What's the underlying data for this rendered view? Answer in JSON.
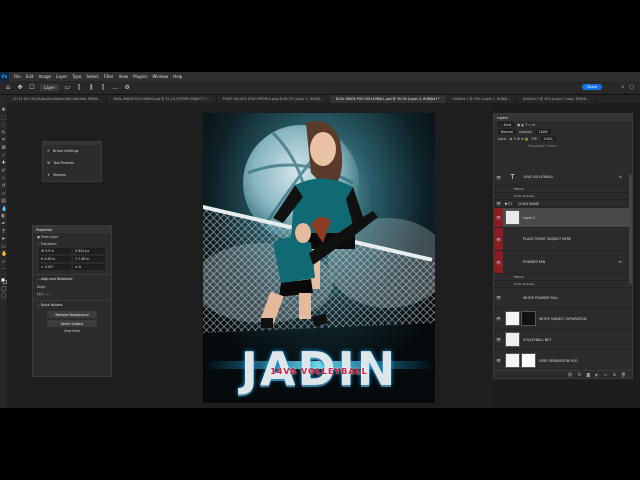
{
  "menubar": {
    "logo": "Ps",
    "items": [
      "File",
      "Edit",
      "Image",
      "Layer",
      "Type",
      "Select",
      "Filter",
      "View",
      "Plugins",
      "Window",
      "Help"
    ]
  },
  "optbar": {
    "layer_select": "Layer",
    "share_label": "Share"
  },
  "tabs": [
    {
      "label": "CH 11 US 178 (N-Box)/Invitation/Test AlionNet, R68/8...",
      "active": false
    },
    {
      "label": "DUAL IMAGE POG DARKS.psd @ 31.1% (STRIPE SUBJECT C...",
      "active": false
    },
    {
      "label": "POINT VILLAGE LOGO PROFILE.png @ 68.7% (Layer 1, RGB/8...",
      "active": false
    },
    {
      "label": "DUAL IMAGE POG VOLLEYBALL.psd @ 39.1% (Layer 2, RGB/8#) *",
      "active": true
    },
    {
      "label": "Untitled-1 @ 45% (Layer 1, RGB/8...",
      "active": false
    },
    {
      "label": "Untitled-3 @ 45% (Layer 1 copy, RGB/8...",
      "active": false
    }
  ],
  "float_panel": {
    "items": [
      "Brush Settings",
      "Tool Presets",
      "Shapes"
    ]
  },
  "properties": {
    "title": "Properties",
    "kind": "Pixel Layer",
    "transform_label": "Transform",
    "w": "3.9 in",
    "h": "4.85 in",
    "x": "624 px",
    "y": "2.38 in",
    "angle": "0.00°",
    "align_label": "Align and Distribute",
    "align_sub": "Align:",
    "quick_label": "Quick Actions",
    "btn_remove_bg": "Remove Background",
    "btn_select_subject": "Select Subject",
    "view_more": "View More"
  },
  "poster": {
    "name": "JADIN",
    "subtitle": "14VA VOLLEYBALL"
  },
  "layers_panel": {
    "title": "Layers",
    "filter": "Kind",
    "blend": "Normal",
    "opacity_label": "Opacity:",
    "opacity": "100%",
    "lock_label": "Lock:",
    "fill_label": "Fill:",
    "fill": "100%",
    "propagate": "Propagate Frame",
    "rows": [
      {
        "name": "14VA VOLLEYBALL",
        "kind": "text",
        "fx": "fx",
        "red": false,
        "selected": false
      },
      {
        "name": "Effects",
        "kind": "sub"
      },
      {
        "name": "Color Overlay",
        "kind": "sub"
      },
      {
        "name": "CHILD NAME",
        "kind": "folder",
        "fx": "",
        "red": false,
        "selected": false
      },
      {
        "name": "Layer 2",
        "kind": "pixel",
        "fx": "",
        "red": true,
        "selected": true
      },
      {
        "name": "PLACE FRONT SUBJECT HERE",
        "kind": "pixel",
        "fx": "",
        "red": true,
        "selected": false
      },
      {
        "name": "POWDER FAN",
        "kind": "pixel",
        "fx": "fx",
        "red": true,
        "selected": false
      },
      {
        "name": "Effects",
        "kind": "sub"
      },
      {
        "name": "Color Overlay",
        "kind": "sub"
      },
      {
        "name": "WHITE POWDER FALL",
        "kind": "pixel",
        "fx": "",
        "red": false,
        "selected": false
      },
      {
        "name": "WHITE SUBJECT SEPARATION",
        "kind": "masked",
        "fx": "",
        "red": false,
        "selected": false
      },
      {
        "name": "VOLLEYBALL NET",
        "kind": "pixel",
        "fx": "",
        "red": false,
        "selected": false
      },
      {
        "name": "GREY SEPARATION POG",
        "kind": "masked",
        "fx": "",
        "red": false,
        "selected": false
      }
    ]
  },
  "colors": {
    "accent": "#1473e6",
    "layer_red": "#8b1c24",
    "teal": "#1aa3b5"
  }
}
